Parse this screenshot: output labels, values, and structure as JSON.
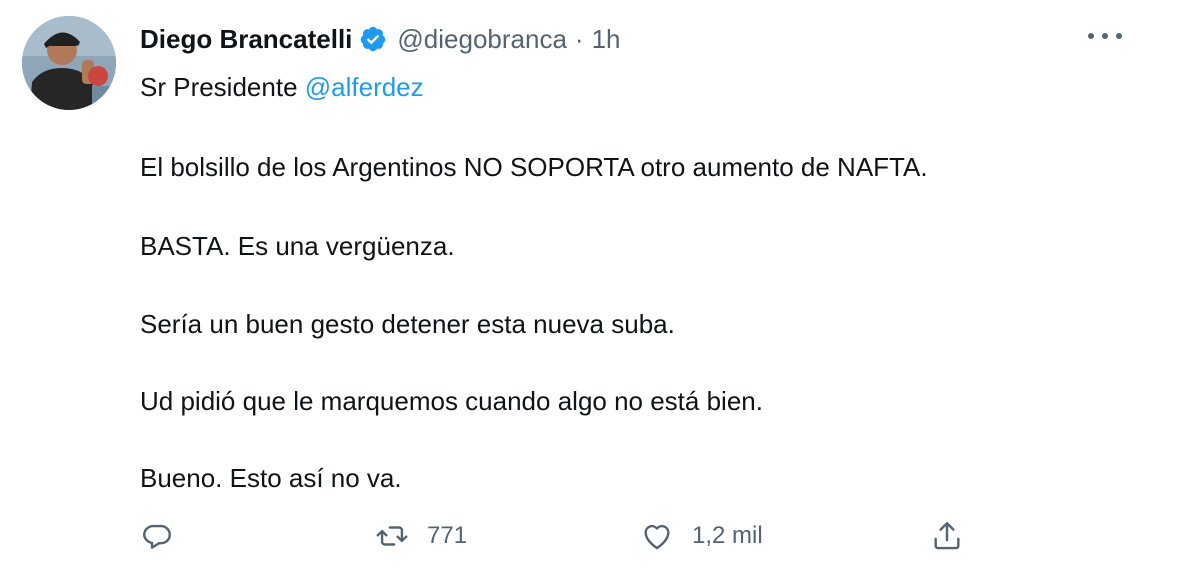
{
  "tweet": {
    "author": {
      "display_name": "Diego Brancatelli",
      "handle": "@diegobranca",
      "verified": true,
      "avatar_icon": "profile-photo"
    },
    "separator": "·",
    "time": "1h",
    "more_icon": "more-horizontal-icon",
    "text": {
      "greeting": "Sr Presidente ",
      "mention": "@alferdez",
      "paragraphs": [
        "El bolsillo de los Argentinos NO SOPORTA otro aumento de NAFTA.",
        "BASTA. Es una vergüenza.",
        "Sería un buen gesto detener esta nueva suba.",
        "Ud pidió que le marquemos cuando algo no está bien.",
        "Bueno. Esto así no va."
      ]
    },
    "actions": {
      "reply": {
        "icon": "reply-icon"
      },
      "retweet": {
        "icon": "retweet-icon",
        "count": "771"
      },
      "like": {
        "icon": "heart-icon",
        "count": "1,2 mil"
      },
      "share": {
        "icon": "share-icon"
      }
    }
  },
  "colors": {
    "text": "#0f1419",
    "secondary": "#536471",
    "accent": "#1d9bf0",
    "background": "#ffffff"
  }
}
